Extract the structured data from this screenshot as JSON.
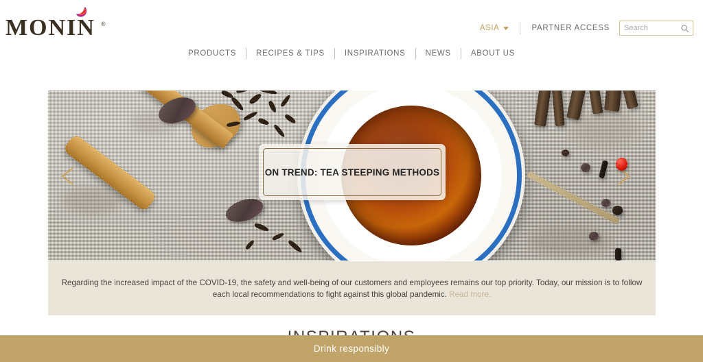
{
  "header": {
    "logo": {
      "wordmark": "MONIN",
      "registered": "®",
      "icon": "monin-droplet-icon"
    },
    "region_selector": {
      "label": "ASIA",
      "icon": "chevron-down-icon"
    },
    "partner_access": "PARTNER ACCESS",
    "search": {
      "value": "",
      "placeholder": "Search",
      "icon": "search-icon"
    },
    "nav": [
      {
        "label": "PRODUCTS"
      },
      {
        "label": "RECIPES & TIPS"
      },
      {
        "label": "INSPIRATIONS"
      },
      {
        "label": "NEWS"
      },
      {
        "label": "ABOUT US"
      }
    ]
  },
  "hero": {
    "caption": "ON TREND: TEA STEEPING METHODS",
    "prev_icon": "chevron-left-icon",
    "next_icon": "chevron-right-icon"
  },
  "notice": {
    "body": "Regarding the increased impact of the COVID-19, the safety and well-being of our customers and employees remains our top priority. Today, our mission is to follow each local recommendations to fight against this global pandemic.",
    "link": "Read more."
  },
  "section": {
    "heading": "INSPIRATIONS"
  },
  "footer": {
    "message": "Drink responsibly"
  },
  "colors": {
    "accent_gold": "#c0a46a",
    "region_gold": "#c3a15f",
    "nav_gray": "#6b6b6b",
    "notice_bg": "#e9e5d9",
    "logo_brown": "#3b2f22",
    "link_tan": "#c9b795"
  }
}
